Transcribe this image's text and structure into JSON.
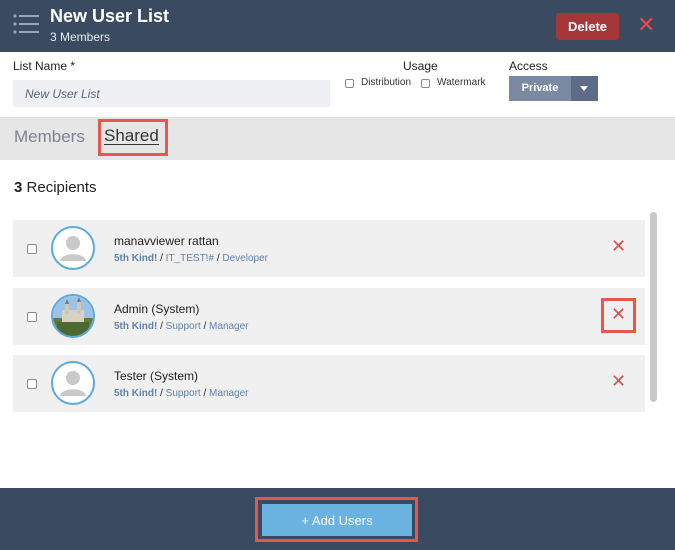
{
  "header": {
    "title": "New User List",
    "subtitle": "3 Members",
    "delete_label": "Delete",
    "close_glyph": "✕",
    "colors": {
      "bar": "#3a4a61",
      "delete": "#a5363a",
      "close": "#e64a4a"
    }
  },
  "form": {
    "list_name_label": "List Name *",
    "list_name_value": "New User List",
    "usage_label": "Usage",
    "usage_options": [
      {
        "label": "Distribution",
        "checked": false
      },
      {
        "label": "Watermark",
        "checked": false
      }
    ],
    "access_label": "Access",
    "access_value": "Private"
  },
  "tabs": [
    {
      "label": "Members",
      "active": false
    },
    {
      "label": "Shared",
      "active": true
    }
  ],
  "recipients": {
    "count": "3",
    "label": "Recipients"
  },
  "users": [
    {
      "name": "manavviewer rattan",
      "org": "5th Kind!",
      "dept": "IT_TEST!#",
      "role": "Developer",
      "avatar": "default-avatar-icon"
    },
    {
      "name": "Admin (System)",
      "org": "5th Kind!",
      "dept": "Support",
      "role": "Manager",
      "avatar": "castle-photo"
    },
    {
      "name": "Tester (System)",
      "org": "5th Kind!",
      "dept": "Support",
      "role": "Manager",
      "avatar": "default-avatar-icon"
    }
  ],
  "remove_glyph": "✕",
  "separator": "/",
  "footer": {
    "add_label": "+ Add Users"
  }
}
